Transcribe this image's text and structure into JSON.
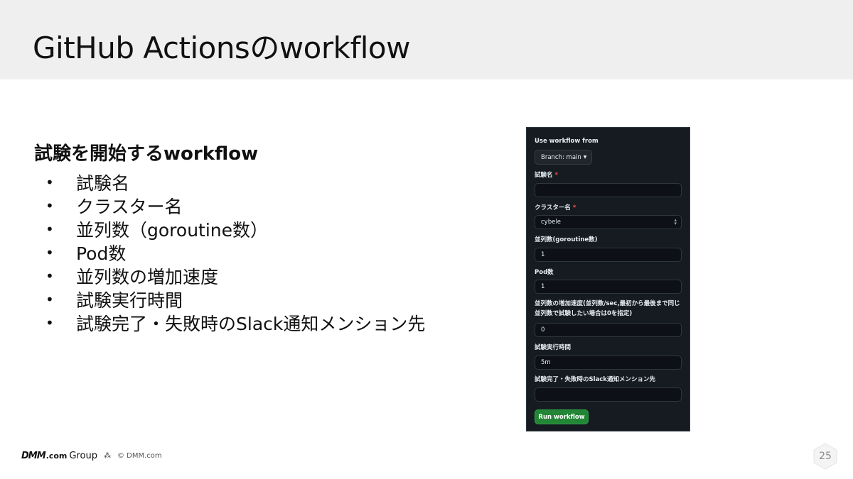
{
  "slide": {
    "title": "GitHub Actionsのworkflow",
    "section_heading": "試験を開始するworkflow",
    "bullets": [
      "試験名",
      "クラスター名",
      "並列数（goroutine数）",
      "Pod数",
      "並列数の増加速度",
      "試験実行時間",
      "試験完了・失敗時のSlack通知メンション先"
    ],
    "bullet_glyph": "•"
  },
  "workflow_form": {
    "use_workflow_from_label": "Use workflow from",
    "branch_label": "Branch: main",
    "fields": [
      {
        "label": "試験名",
        "required": true,
        "value": ""
      },
      {
        "label": "クラスター名",
        "required": true,
        "value": "cybele"
      },
      {
        "label": "並列数(goroutine数)",
        "required": false,
        "value": "1"
      },
      {
        "label": "Pod数",
        "required": false,
        "value": "1"
      },
      {
        "label": "並列数の増加速度(並列数/sec,最初から最後まで同じ並列数で試験したい場合は0を指定)",
        "required": false,
        "value": "0"
      },
      {
        "label": "試験実行時間",
        "required": false,
        "value": "5m"
      },
      {
        "label": "試験完了・失敗時のSlack通知メンション先",
        "required": false,
        "value": ""
      }
    ],
    "required_marker": "*",
    "run_button_label": "Run workflow",
    "colors": {
      "panel_bg": "#161b22",
      "input_bg": "#0d1117",
      "run_button": "#238636",
      "required": "#f85149"
    }
  },
  "footer": {
    "logo_brand": "DMM",
    "logo_domain": ".com",
    "logo_group": "Group",
    "copyright": "© DMM.com",
    "page_number": "25"
  }
}
